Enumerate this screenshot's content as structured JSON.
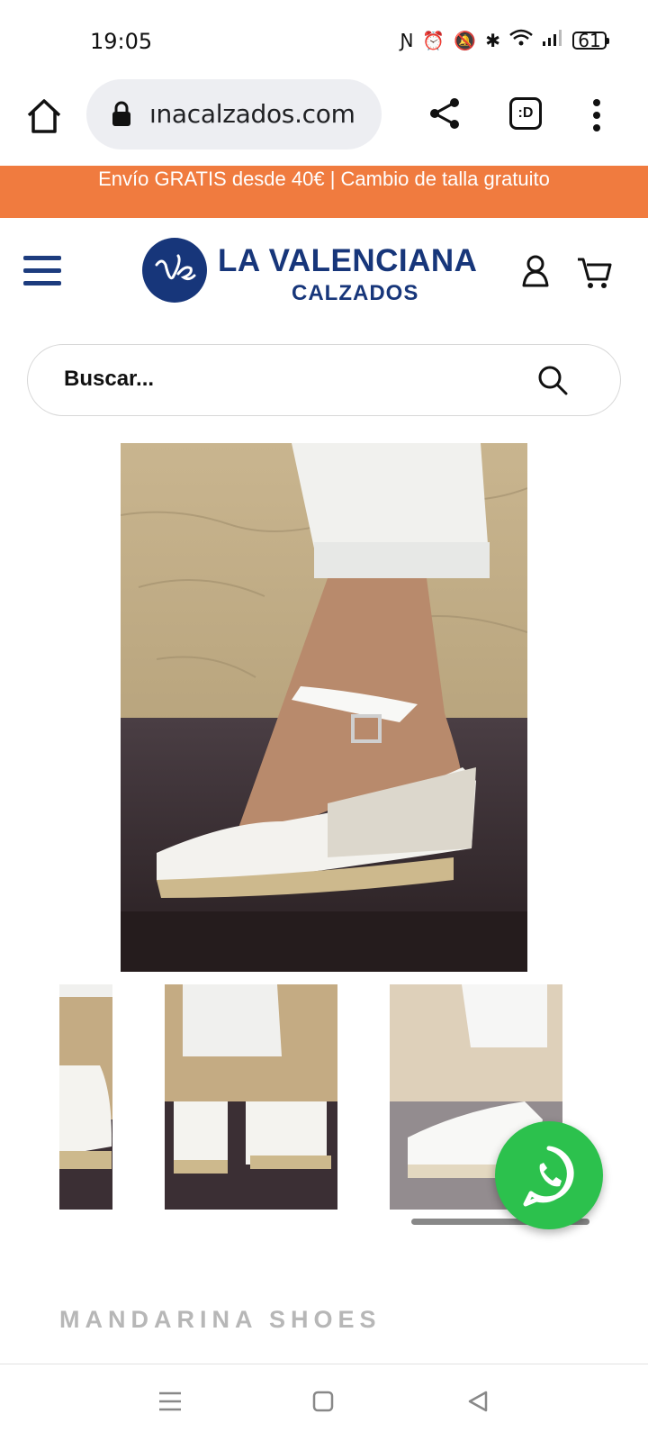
{
  "status_bar": {
    "time": "19:05",
    "icons": [
      "nfc-icon",
      "alarm-icon",
      "mute-icon",
      "bluetooth-icon",
      "wifi-icon",
      "signal-icon"
    ],
    "battery": "61"
  },
  "browser": {
    "url": "ınacalzados.com",
    "tab_label": ":D"
  },
  "promo_banner": {
    "text": "Envío GRATIS desde 40€ | Cambio de talla gratuito",
    "color": "#f07b3f"
  },
  "header": {
    "logo_line1": "LA VALENCIANA",
    "logo_line2": "CALZADOS",
    "logo_mark": "ve",
    "brand_color": "#17367a"
  },
  "search": {
    "placeholder": "Buscar..."
  },
  "product": {
    "brand": "MANDARINA SHOES",
    "thumbnail_count": 3
  },
  "whatsapp": {
    "color": "#2cc14d"
  }
}
